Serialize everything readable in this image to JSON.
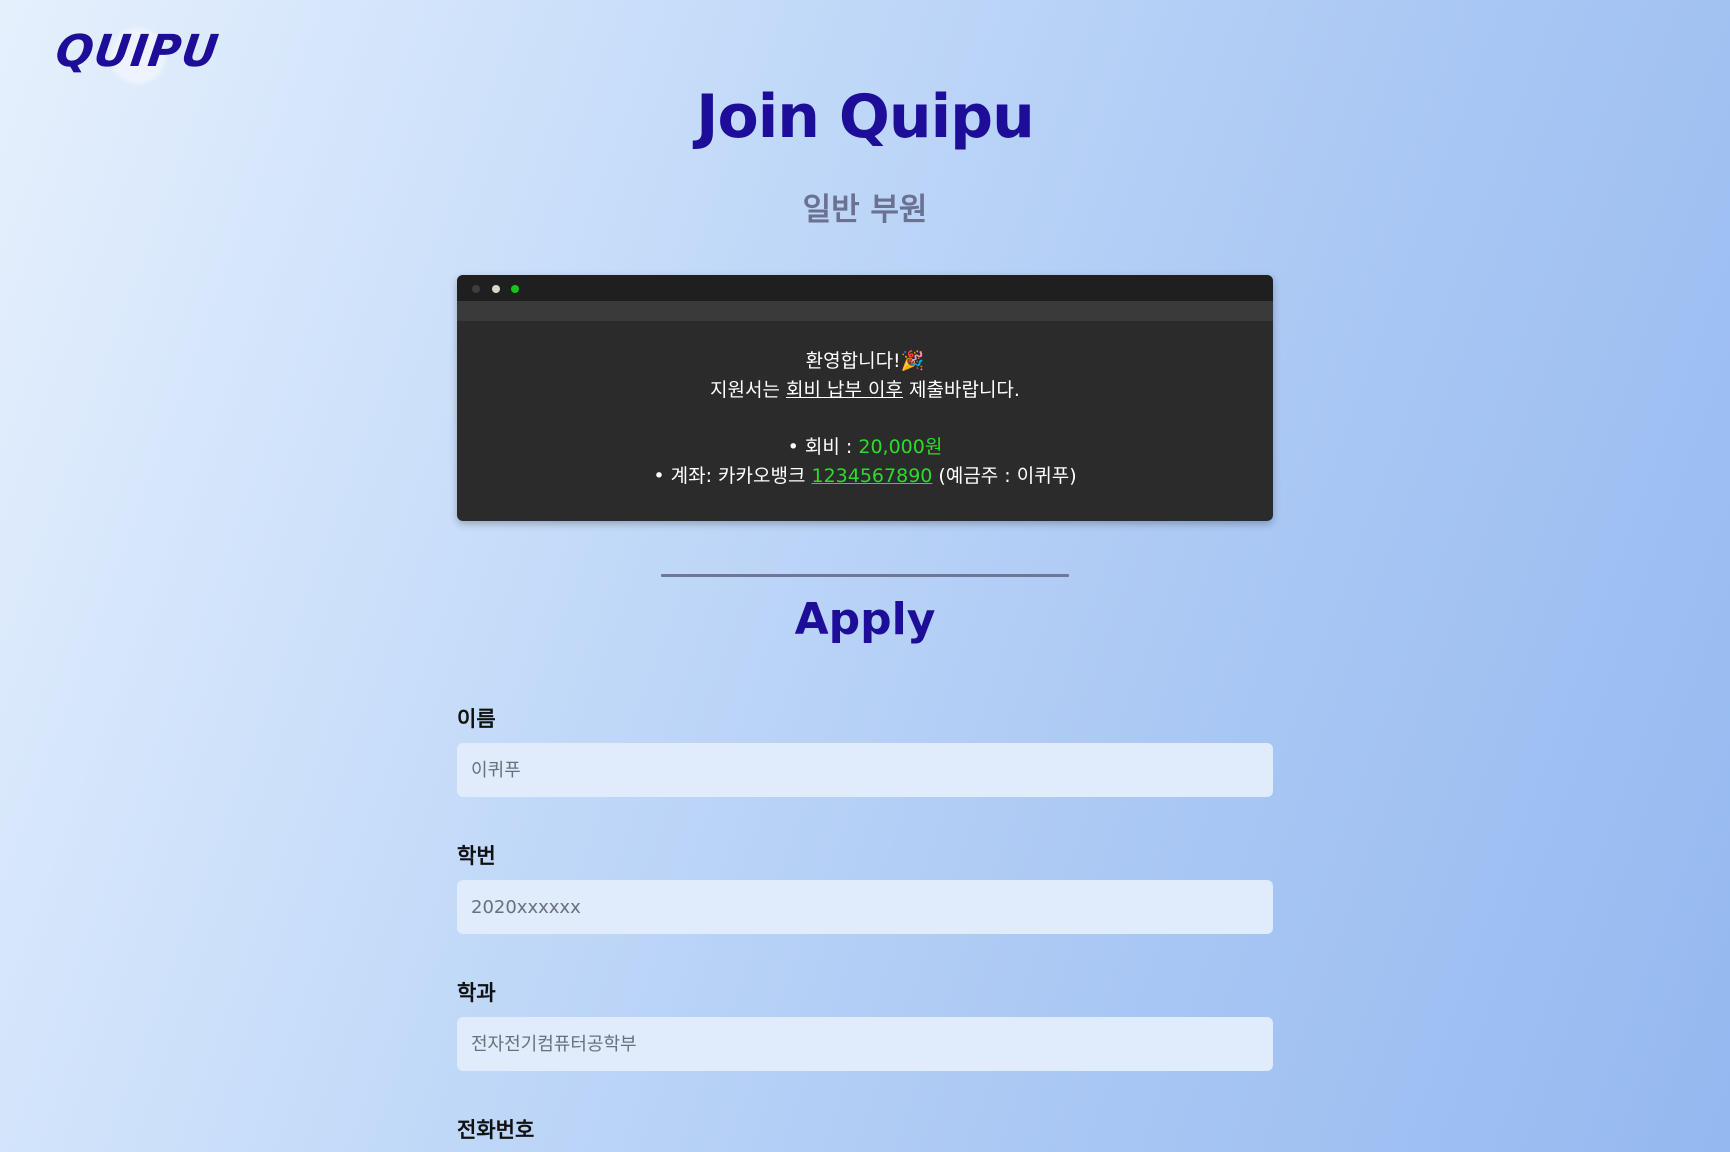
{
  "header": {
    "logo": "QUIPU"
  },
  "page": {
    "title": "Join Quipu",
    "subtitle": "일반 부원"
  },
  "notice": {
    "line1": "환영합니다!🎉",
    "line2_prefix": "지원서는 ",
    "line2_emphasis": "회비 납부 이후",
    "line2_suffix": " 제출바랍니다.",
    "fee_label": "•  회비 : ",
    "fee_value": "20,000원",
    "account_label": "•  계좌: 카카오뱅크 ",
    "account_number": "1234567890",
    "account_holder": " (예금주 : 이퀴푸)"
  },
  "form": {
    "heading": "Apply",
    "fields": [
      {
        "label": "이름",
        "placeholder": "이퀴푸"
      },
      {
        "label": "학번",
        "placeholder": "2020xxxxxx"
      },
      {
        "label": "학과",
        "placeholder": "전자전기컴퓨터공학부"
      },
      {
        "label": "전화번호",
        "placeholder": ""
      }
    ]
  },
  "colors": {
    "brand": "#1d0d99",
    "accent_green": "#2cdc2c",
    "terminal_bg": "#2b2b2b"
  }
}
